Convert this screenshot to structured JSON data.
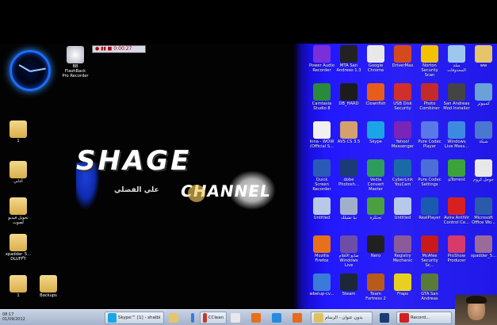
{
  "recorder_bar": {
    "time": "0:00:27"
  },
  "left_icons": [
    {
      "label": "BB FlashBack Pro Recorder",
      "icon": "flashback-icon"
    },
    {
      "label": "1",
      "icon": "folder-icon"
    },
    {
      "label": "أغاني",
      "icon": "folder-icon"
    },
    {
      "label": "تحويل فيديو لصوت",
      "icon": "folder-icon"
    },
    {
      "label": "xpadder_5... DLUFFY",
      "icon": "folder-icon"
    },
    {
      "label": "1",
      "icon": "folder-icon"
    },
    {
      "label": "Backups",
      "icon": "folder-icon"
    }
  ],
  "logo": {
    "title": "SHAGE",
    "subtitle": "CHANNEL",
    "arabic": "علي الفضلي"
  },
  "right_icons": [
    {
      "label": "Power Audio Recorder",
      "icon": "music-icon",
      "color": "#7b2fd8"
    },
    {
      "label": "MTA San Andreas 1.3",
      "icon": "mta-icon",
      "color": "#222222"
    },
    {
      "label": "Google Chrome",
      "icon": "chrome-icon",
      "color": "#e8e8e8"
    },
    {
      "label": "DriverMax",
      "icon": "drivermax-icon",
      "color": "#d44a1c"
    },
    {
      "label": "Norton Security Scan",
      "icon": "norton-icon",
      "color": "#f2c100"
    },
    {
      "label": "سلة المحذوفات",
      "icon": "recycle-bin-icon",
      "color": "#9ec7ee"
    },
    {
      "label": "ww",
      "icon": "folder-icon",
      "color": "#e6c46a"
    },
    {
      "label": "Camtasia Studio 8",
      "icon": "camtasia-icon",
      "color": "#2a8a3a"
    },
    {
      "label": "DB_HARD",
      "icon": "di-icon",
      "color": "#1c1c1c"
    },
    {
      "label": "Clownfish",
      "icon": "clownfish-icon",
      "color": "#e85d1a"
    },
    {
      "label": "USB Disk Security",
      "icon": "usb-icon",
      "color": "#d0302a"
    },
    {
      "label": "Photo Combiner",
      "icon": "photo-icon",
      "color": "#c42a2a"
    },
    {
      "label": "San Andreas Mod Installer",
      "icon": "sa-icon",
      "color": "#444444"
    },
    {
      "label": "كمبيوتر",
      "icon": "computer-icon",
      "color": "#6aa2d8"
    },
    {
      "label": "Inna - WOW (Official S...",
      "icon": "video-file-icon",
      "color": "#f0f0f0"
    },
    {
      "label": "AVS CS 3.5",
      "icon": "avs-icon",
      "color": "#d2a16e"
    },
    {
      "label": "Skype",
      "icon": "skype-icon",
      "color": "#1aa6e6"
    },
    {
      "label": "Yahoo! Messenger",
      "icon": "yahoo-icon",
      "color": "#7a24b8"
    },
    {
      "label": "Pure Codec Player",
      "icon": "player-icon",
      "color": "#5a78e8"
    },
    {
      "label": "Windows Live Mess...",
      "icon": "wlm-icon",
      "color": "#3d8be0"
    },
    {
      "label": "شبكة",
      "icon": "network-icon",
      "color": "#4a78d0"
    },
    {
      "label": "Quick Screen Recorder",
      "icon": "qsr-icon",
      "color": "#2a5ab8"
    },
    {
      "label": "dobe Photosh...",
      "icon": "photoshop-icon",
      "color": "#1a3a78"
    },
    {
      "label": "Vedia Convert Master",
      "icon": "convert-icon",
      "color": "#2e9c5e"
    },
    {
      "label": "CyberLink YouCam",
      "icon": "youcam-icon",
      "color": "#1a6aa8"
    },
    {
      "label": "Pure Codec Settings",
      "icon": "settings-icon",
      "color": "#4c6ed8"
    },
    {
      "label": "µTorrent",
      "icon": "utorrent-icon",
      "color": "#3aa33a"
    },
    {
      "label": "جوجل كروم",
      "icon": "chrome-icon",
      "color": "#e8e8e8"
    },
    {
      "label": "Untitled",
      "icon": "file-icon",
      "color": "#b8c8e8"
    },
    {
      "label": "بيا تشيلك",
      "icon": "file-icon",
      "color": "#a0b0c8"
    },
    {
      "label": "تحتكرة",
      "icon": "file-icon",
      "color": "#4aa040"
    },
    {
      "label": "Untitled",
      "icon": "file-icon",
      "color": "#b8c8e8"
    },
    {
      "label": "RealPlayer",
      "icon": "realplayer-icon",
      "color": "#1a5ab0"
    },
    {
      "label": "Avira AntiVir Control Ce...",
      "icon": "avira-icon",
      "color": "#d82020"
    },
    {
      "label": "Microsoft Office Wo...",
      "icon": "word-icon",
      "color": "#2a5aaa"
    },
    {
      "label": "Mozilla Firefox",
      "icon": "firefox-icon",
      "color": "#e8701a"
    },
    {
      "label": "صانع الأفلام Windows Live",
      "icon": "movie-maker-icon",
      "color": "#6c4ea8"
    },
    {
      "label": "Nero",
      "icon": "nero-icon",
      "color": "#202020"
    },
    {
      "label": "Registry Mechanic",
      "icon": "registry-icon",
      "color": "#8a5a9a"
    },
    {
      "label": "McAfee Security Sc...",
      "icon": "mcafee-icon",
      "color": "#c81a1a"
    },
    {
      "label": "ProShow Producer",
      "icon": "proshow-icon",
      "color": "#d83a6a"
    },
    {
      "label": "xpadder_5...",
      "icon": "archive-icon",
      "color": "#9a6a9a"
    },
    {
      "label": "wbelup-cv...",
      "icon": "windows-icon",
      "color": "#3a7ad8"
    },
    {
      "label": "Steam",
      "icon": "steam-icon",
      "color": "#1c2838"
    },
    {
      "label": "Team Fortress 2",
      "icon": "tf2-icon",
      "color": "#b85a1a"
    },
    {
      "label": "Fraps",
      "icon": "fraps-icon",
      "color": "#e8d020"
    },
    {
      "label": "GTA San Andreas",
      "icon": "gta-icon",
      "color": "#5a7a3a"
    }
  ],
  "taskbar": {
    "clock_time": "08:17",
    "clock_date": "01/09/2012",
    "items": [
      {
        "label": "Skype™ [1] - shalbi...",
        "icon": "skype-icon",
        "color": "#1aa6e6"
      },
      {
        "label": "",
        "icon": "folder-icon",
        "color": "#e6c46a"
      },
      {
        "label": "",
        "icon": "windows-icon",
        "color": "#3a7ad8"
      },
      {
        "label": "CCleaner - CNET...",
        "icon": "ccleaner-icon",
        "color": "#c8382a"
      },
      {
        "label": "",
        "icon": "chrome-icon",
        "color": "#e8e8e8"
      },
      {
        "label": "",
        "icon": "firefox-icon",
        "color": "#e8701a"
      },
      {
        "label": "",
        "icon": "ie-icon",
        "color": "#2a8ae0"
      },
      {
        "label": "",
        "icon": "media-player-icon",
        "color": "#e86a1a"
      },
      {
        "label": "بدون عنوان - الرسام",
        "icon": "paint-icon",
        "color": "#e0c060"
      },
      {
        "label": "",
        "icon": "photoshop-icon",
        "color": "#1a3a78"
      },
      {
        "label": "Record...",
        "icon": "record-icon",
        "color": "#d02020"
      }
    ]
  }
}
